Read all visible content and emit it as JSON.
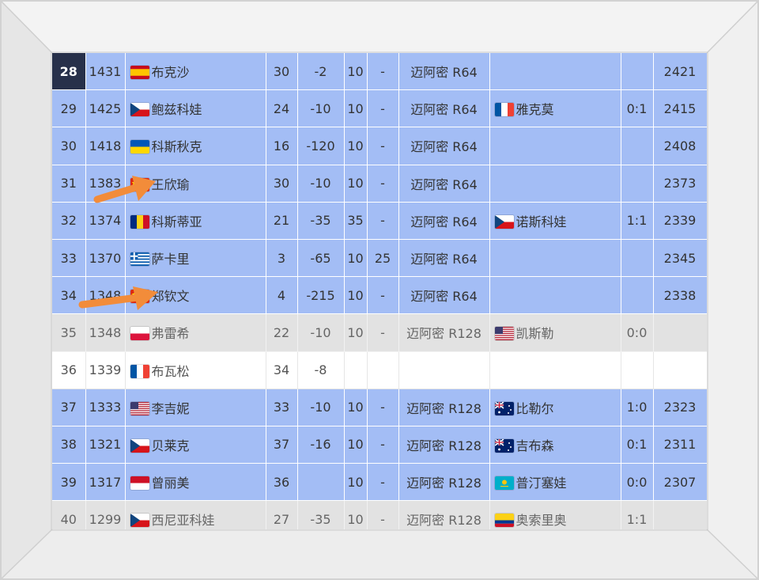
{
  "colors": {
    "row_blue": "#a3bdf5",
    "row_gray": "#e2e2e2",
    "row_white": "#ffffff",
    "rank_highlight": "#27304a",
    "arrow": "#f28c3a"
  },
  "rows": [
    {
      "rank": "28",
      "points": "1431",
      "flag": "spain-flag-icon",
      "name": "布克沙",
      "age": "30",
      "change": "-2",
      "pts_a": "10",
      "pts_b": "-",
      "tournament": "迈阿密 R64",
      "opp_flag": "",
      "opponent": "",
      "h2h": "",
      "total": "2421",
      "style": "blue",
      "highlight_rank": true
    },
    {
      "rank": "29",
      "points": "1425",
      "flag": "czech-flag-icon",
      "name": "鲍兹科娃",
      "age": "24",
      "change": "-10",
      "pts_a": "10",
      "pts_b": "-",
      "tournament": "迈阿密 R64",
      "opp_flag": "france-flag-icon",
      "opponent": "雅克莫",
      "h2h": "0:1",
      "total": "2415",
      "style": "blue"
    },
    {
      "rank": "30",
      "points": "1418",
      "flag": "ukraine-flag-icon",
      "name": "科斯秋克",
      "age": "16",
      "change": "-120",
      "pts_a": "10",
      "pts_b": "-",
      "tournament": "迈阿密 R64",
      "opp_flag": "",
      "opponent": "",
      "h2h": "",
      "total": "2408",
      "style": "blue"
    },
    {
      "rank": "31",
      "points": "1383",
      "flag": "china-flag-icon",
      "name": "王欣瑜",
      "age": "30",
      "change": "-10",
      "pts_a": "10",
      "pts_b": "-",
      "tournament": "迈阿密 R64",
      "opp_flag": "",
      "opponent": "",
      "h2h": "",
      "total": "2373",
      "style": "blue"
    },
    {
      "rank": "32",
      "points": "1374",
      "flag": "romania-flag-icon",
      "name": "科斯蒂亚",
      "age": "21",
      "change": "-35",
      "pts_a": "35",
      "pts_b": "-",
      "tournament": "迈阿密 R64",
      "opp_flag": "czech-flag-icon",
      "opponent": "诺斯科娃",
      "h2h": "1:1",
      "total": "2339",
      "style": "blue"
    },
    {
      "rank": "33",
      "points": "1370",
      "flag": "greece-flag-icon",
      "name": "萨卡里",
      "age": "3",
      "change": "-65",
      "pts_a": "10",
      "pts_b": "25",
      "tournament": "迈阿密 R64",
      "opp_flag": "",
      "opponent": "",
      "h2h": "",
      "total": "2345",
      "style": "blue"
    },
    {
      "rank": "34",
      "points": "1348",
      "flag": "china-flag-icon",
      "name": "郑钦文",
      "age": "4",
      "change": "-215",
      "pts_a": "10",
      "pts_b": "-",
      "tournament": "迈阿密 R64",
      "opp_flag": "",
      "opponent": "",
      "h2h": "",
      "total": "2338",
      "style": "blue"
    },
    {
      "rank": "35",
      "points": "1348",
      "flag": "poland-flag-icon",
      "name": "弗雷希",
      "age": "22",
      "change": "-10",
      "pts_a": "10",
      "pts_b": "-",
      "tournament": "迈阿密 R128",
      "opp_flag": "usa-flag-icon",
      "opponent": "凯斯勒",
      "h2h": "0:0",
      "total": "",
      "style": "gray"
    },
    {
      "rank": "36",
      "points": "1339",
      "flag": "france-flag-icon",
      "name": "布瓦松",
      "age": "34",
      "change": "-8",
      "pts_a": "",
      "pts_b": "",
      "tournament": "",
      "opp_flag": "",
      "opponent": "",
      "h2h": "",
      "total": "",
      "style": "white"
    },
    {
      "rank": "37",
      "points": "1333",
      "flag": "usa-flag-icon",
      "name": "李吉妮",
      "age": "33",
      "change": "-10",
      "pts_a": "10",
      "pts_b": "-",
      "tournament": "迈阿密 R128",
      "opp_flag": "australia-flag-icon",
      "opponent": "比勒尔",
      "h2h": "1:0",
      "total": "2323",
      "style": "blue"
    },
    {
      "rank": "38",
      "points": "1321",
      "flag": "czech-flag-icon",
      "name": "贝莱克",
      "age": "37",
      "change": "-16",
      "pts_a": "10",
      "pts_b": "-",
      "tournament": "迈阿密 R128",
      "opp_flag": "australia-flag-icon",
      "opponent": "吉布森",
      "h2h": "0:1",
      "total": "2311",
      "style": "blue"
    },
    {
      "rank": "39",
      "points": "1317",
      "flag": "indonesia-flag-icon",
      "name": "曾丽美",
      "age": "36",
      "change": "",
      "pts_a": "10",
      "pts_b": "-",
      "tournament": "迈阿密 R128",
      "opp_flag": "kazakhstan-flag-icon",
      "opponent": "普汀塞娃",
      "h2h": "0:0",
      "total": "2307",
      "style": "blue"
    },
    {
      "rank": "40",
      "points": "1299",
      "flag": "czech-flag-icon",
      "name": "西尼亚科娃",
      "age": "27",
      "change": "-35",
      "pts_a": "10",
      "pts_b": "-",
      "tournament": "迈阿密 R128",
      "opp_flag": "colombia-flag-icon",
      "opponent": "奥索里奥",
      "h2h": "1:1",
      "total": "",
      "style": "gray"
    }
  ],
  "annotations": [
    {
      "type": "arrow",
      "points_to": "王欣瑜",
      "icon": "orange-arrow-icon"
    },
    {
      "type": "arrow",
      "points_to": "郑钦文",
      "icon": "orange-arrow-icon"
    }
  ]
}
